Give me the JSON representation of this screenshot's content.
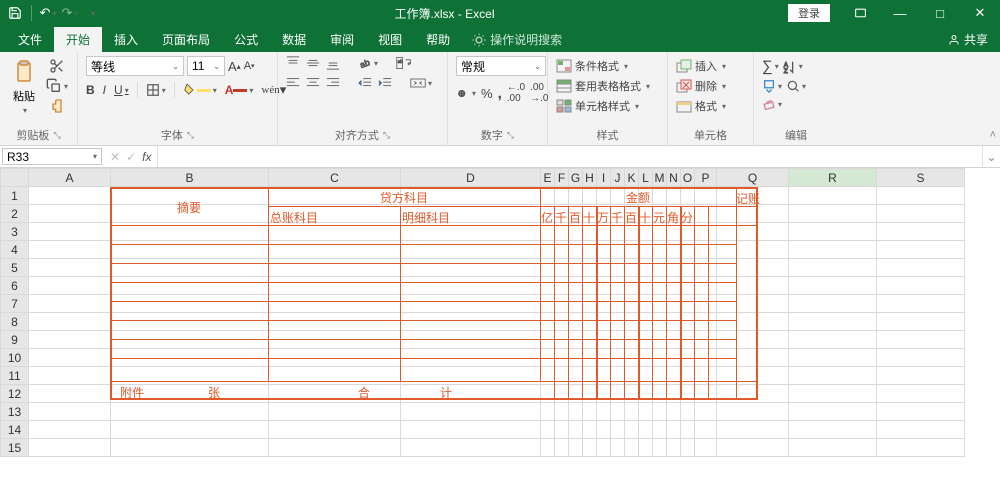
{
  "titlebar": {
    "title_full": "工作簿.xlsx - Excel",
    "login": "登录",
    "icons": {
      "save": "save-icon",
      "undo": "undo-icon",
      "redo": "redo-icon"
    }
  },
  "tabs": {
    "items": [
      "文件",
      "开始",
      "插入",
      "页面布局",
      "公式",
      "数据",
      "审阅",
      "视图",
      "帮助"
    ],
    "active_index": 1,
    "tell_me": "操作说明搜索",
    "share": "共享"
  },
  "ribbon": {
    "clipboard": {
      "label": "剪贴板",
      "paste": "粘贴"
    },
    "font": {
      "label": "字体",
      "name": "等线",
      "size": "11",
      "bold": "B",
      "italic": "I",
      "underline": "U"
    },
    "alignment": {
      "label": "对齐方式"
    },
    "number": {
      "label": "数字",
      "format": "常规"
    },
    "styles": {
      "label": "样式",
      "cond_fmt": "条件格式",
      "table_fmt": "套用表格格式",
      "cell_styles": "单元格样式"
    },
    "cells": {
      "label": "单元格",
      "insert": "插入",
      "delete": "删除",
      "format": "格式"
    },
    "editing": {
      "label": "编辑"
    }
  },
  "namebox": {
    "value": "R33"
  },
  "formula": {
    "fx": "fx",
    "value": ""
  },
  "grid": {
    "columns": [
      "A",
      "B",
      "C",
      "D",
      "E",
      "F",
      "G",
      "H",
      "I",
      "J",
      "K",
      "L",
      "M",
      "N",
      "O",
      "P",
      "Q",
      "R",
      "S"
    ],
    "rows": [
      "1",
      "2",
      "3",
      "4",
      "5",
      "6",
      "7",
      "8",
      "9",
      "10",
      "11",
      "12",
      "13",
      "14",
      "15"
    ],
    "highlight_col": "R"
  },
  "form": {
    "summary": "摘要",
    "credit_subject": "贷方科目",
    "amount": "金额",
    "memo": "记账",
    "general_ledger": "总账科目",
    "detail_ledger": "明细科目",
    "digits": [
      "亿",
      "千",
      "百",
      "十",
      "万",
      "千",
      "百",
      "十",
      "元",
      "角",
      "分"
    ],
    "attachments_pre": "附件",
    "attachments_post": "张",
    "total_he": "合",
    "total_ji": "计"
  }
}
